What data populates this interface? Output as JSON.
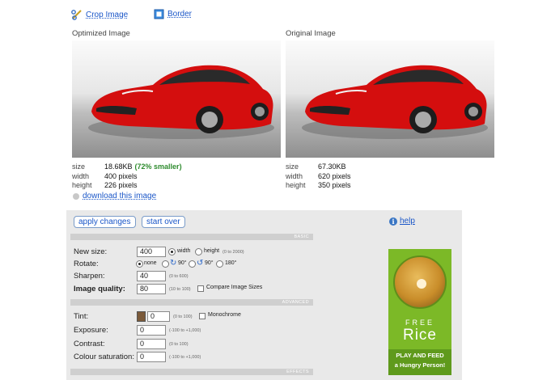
{
  "toolbar": {
    "crop_label": "Crop Image",
    "border_label": "Border"
  },
  "optimized": {
    "title": "Optimized Image",
    "size_label": "size",
    "size_value": "18.68KB",
    "smaller": "(72% smaller)",
    "width_label": "width",
    "width_value": "400 pixels",
    "height_label": "height",
    "height_value": "226 pixels"
  },
  "original": {
    "title": "Original Image",
    "size_label": "size",
    "size_value": "67.30KB",
    "width_label": "width",
    "width_value": "620 pixels",
    "height_label": "height",
    "height_value": "350 pixels"
  },
  "download_label": "download this image",
  "panel": {
    "apply_label": "apply changes",
    "start_over_label": "start over",
    "help_label": "help",
    "sections": {
      "basic": "BASIC",
      "advanced": "ADVANCED",
      "effects": "EFFECTS"
    },
    "new_size": {
      "label": "New size:",
      "value": "400",
      "opt_width": "width",
      "opt_height": "height",
      "hint": "(0 to 2000)"
    },
    "rotate": {
      "label": "Rotate:",
      "opt_none": "none",
      "opt_90cw": "90°",
      "opt_90ccw": "90°",
      "opt_180": "180°"
    },
    "sharpen": {
      "label": "Sharpen:",
      "value": "40",
      "hint": "(0 to 600)"
    },
    "quality": {
      "label": "Image quality:",
      "value": "80",
      "hint": "(10 to 100)",
      "compare_label": "Compare Image Sizes"
    },
    "tint": {
      "label": "Tint:",
      "value": "0",
      "hint": "(0 to 100)",
      "mono_label": "Monochrome",
      "swatch_color": "#7b5a3a"
    },
    "exposure": {
      "label": "Exposure:",
      "value": "0",
      "hint": "(-100 to +1,000)"
    },
    "contrast": {
      "label": "Contrast:",
      "value": "0",
      "hint": "(0 to 100)"
    },
    "saturation": {
      "label": "Colour saturation:",
      "value": "0",
      "hint": "(-100 to +1,000)"
    }
  },
  "ad": {
    "line1": "FREE",
    "line2": "Rice",
    "cta1": "PLAY AND FEED",
    "cta2": "a Hungry Person!"
  }
}
